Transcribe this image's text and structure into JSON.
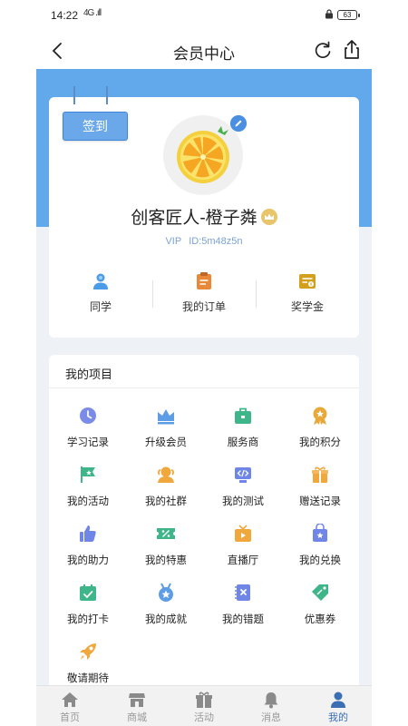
{
  "status_bar": {
    "time": "14:22",
    "signal": "4G .ıll",
    "battery": "63"
  },
  "header": {
    "title": "会员中心"
  },
  "profile": {
    "signin_label": "签到",
    "nickname": "创客匠人-橙子粦",
    "membership": "VIP",
    "user_id": "ID:5m48z5n",
    "quick_links": [
      {
        "label": "同学",
        "icon": "classmates-icon"
      },
      {
        "label": "我的订单",
        "icon": "orders-icon"
      },
      {
        "label": "奖学金",
        "icon": "scholarship-icon"
      }
    ]
  },
  "projects": {
    "title": "我的项目",
    "items": [
      {
        "label": "学习记录",
        "icon": "clock-icon"
      },
      {
        "label": "升级会员",
        "icon": "crown-icon"
      },
      {
        "label": "服务商",
        "icon": "briefcase-icon"
      },
      {
        "label": "我的积分",
        "icon": "medal-icon"
      },
      {
        "label": "我的活动",
        "icon": "flag-icon"
      },
      {
        "label": "我的社群",
        "icon": "community-icon"
      },
      {
        "label": "我的测试",
        "icon": "code-test-icon"
      },
      {
        "label": "赠送记录",
        "icon": "gift-icon"
      },
      {
        "label": "我的助力",
        "icon": "thumbs-up-icon"
      },
      {
        "label": "我的特惠",
        "icon": "discount-ticket-icon"
      },
      {
        "label": "直播厅",
        "icon": "live-tv-icon"
      },
      {
        "label": "我的兑换",
        "icon": "exchange-bag-icon"
      },
      {
        "label": "我的打卡",
        "icon": "calendar-check-icon"
      },
      {
        "label": "我的成就",
        "icon": "achievement-icon"
      },
      {
        "label": "我的错题",
        "icon": "mistake-notebook-icon"
      },
      {
        "label": "优惠券",
        "icon": "coupon-tag-icon"
      },
      {
        "label": "敬请期待",
        "icon": "rocket-icon"
      }
    ]
  },
  "tab_bar": {
    "tabs": [
      {
        "label": "首页",
        "icon": "home-icon"
      },
      {
        "label": "商城",
        "icon": "store-icon"
      },
      {
        "label": "活动",
        "icon": "gift-box-icon"
      },
      {
        "label": "消息",
        "icon": "bell-icon"
      },
      {
        "label": "我的",
        "icon": "user-icon"
      }
    ],
    "active": "我的"
  },
  "colors": {
    "accent_blue": "#62a9ec",
    "signin_button": "#6aa8ea",
    "active_tab": "#3a6fb5",
    "page_background": "#eef1f5"
  }
}
